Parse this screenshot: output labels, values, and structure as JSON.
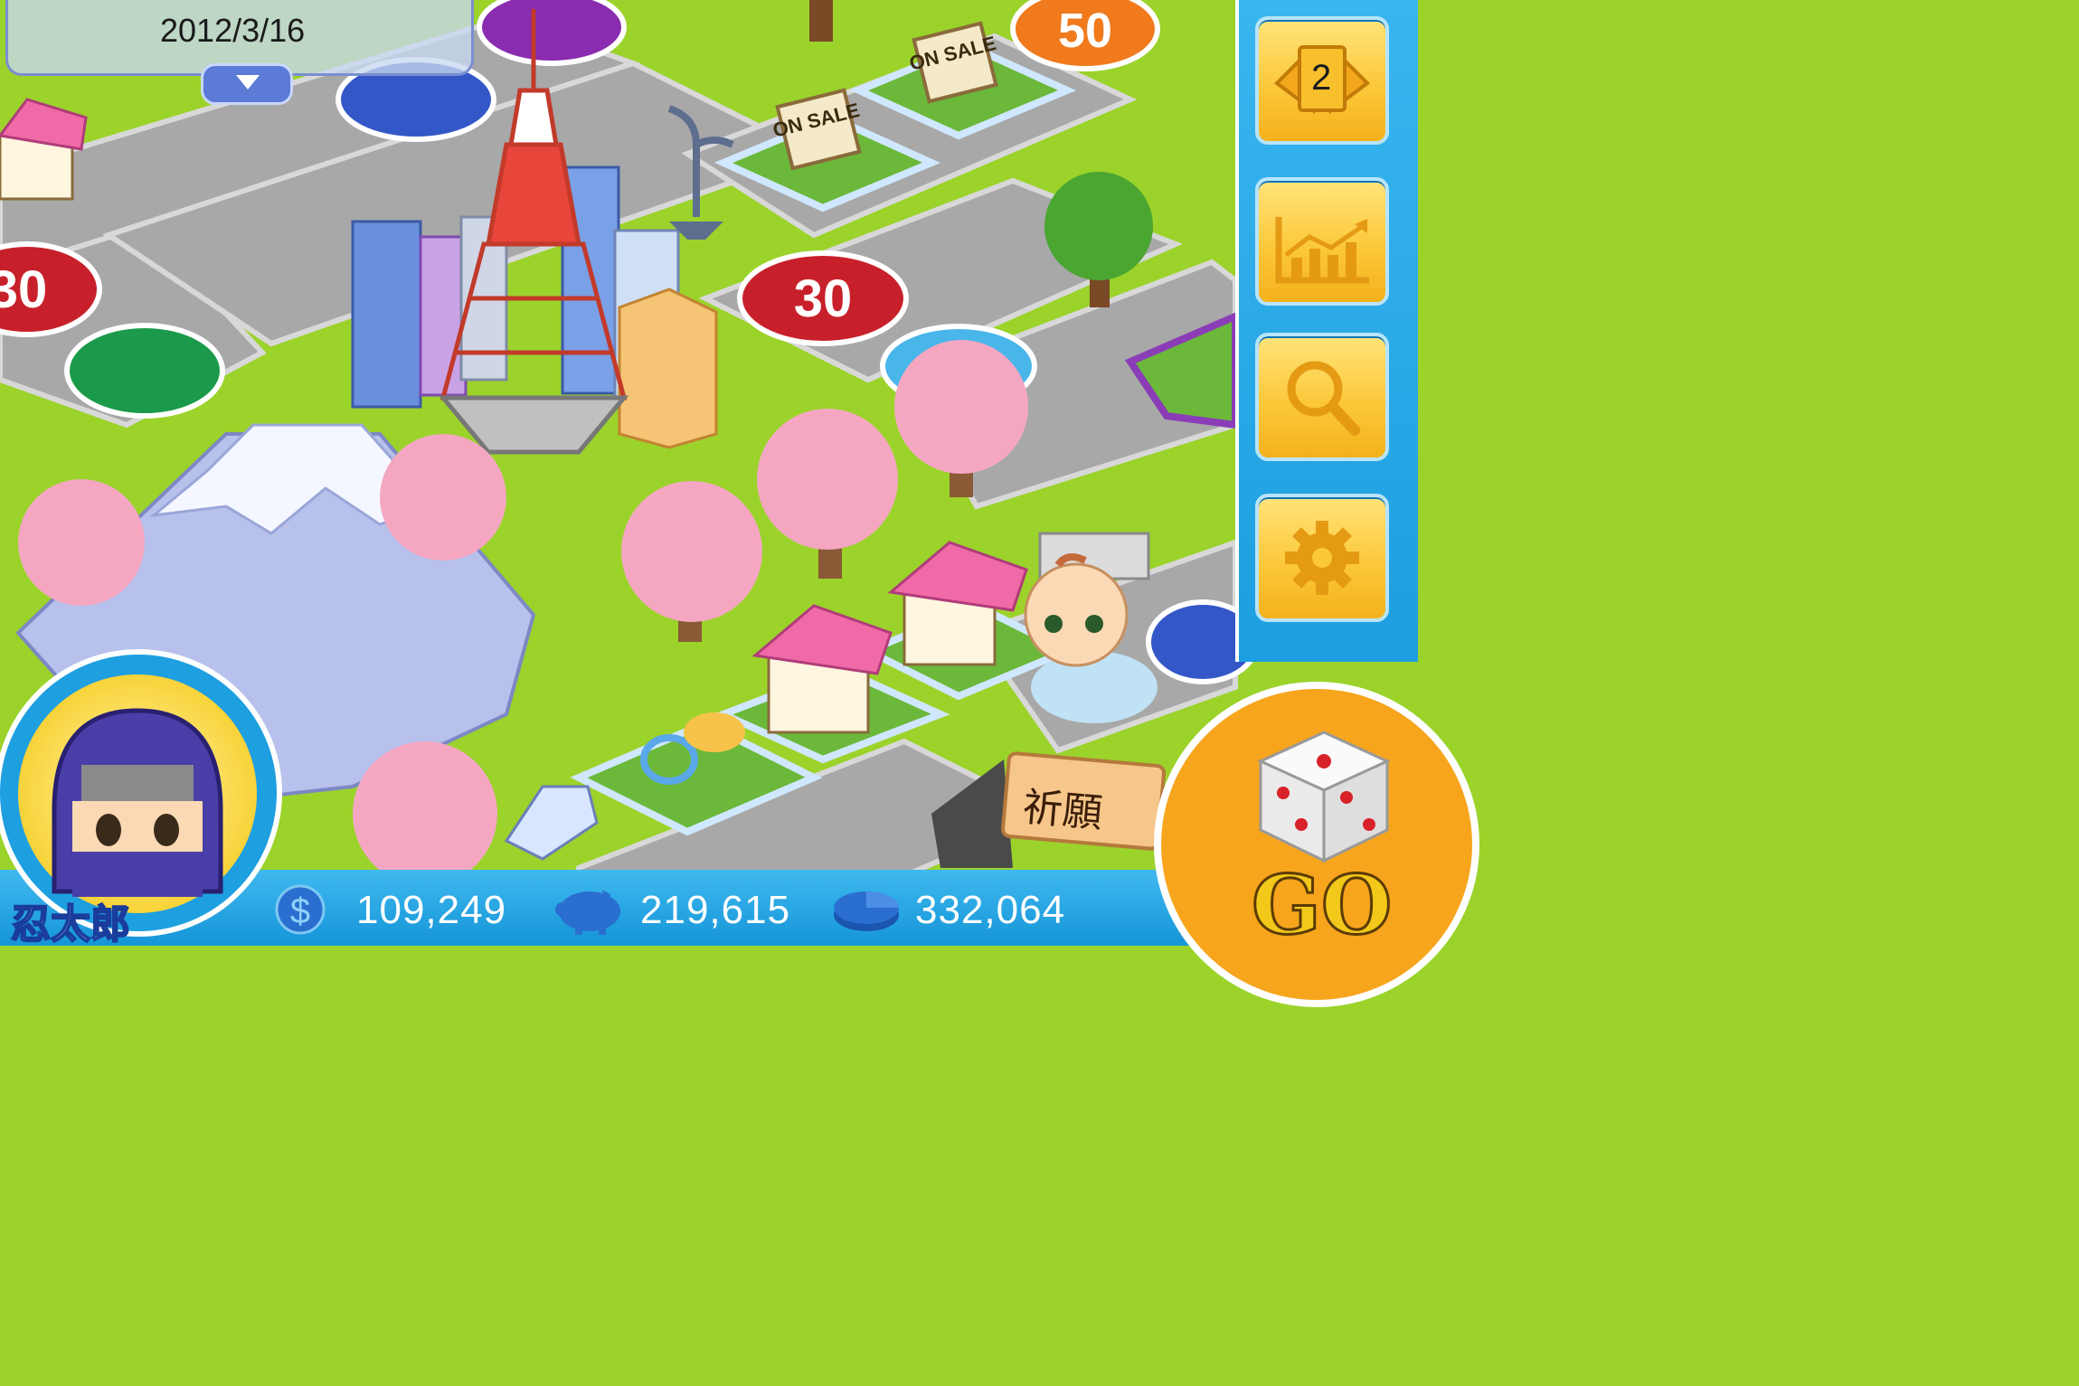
{
  "header": {
    "date": "2012/3/16"
  },
  "side_panel": {
    "buttons": [
      {
        "name": "cards",
        "icon": "cards-icon",
        "count": "2"
      },
      {
        "name": "stocks",
        "icon": "stock-chart-icon"
      },
      {
        "name": "search",
        "icon": "magnifier-icon"
      },
      {
        "name": "settings",
        "icon": "gear-icon"
      }
    ]
  },
  "board": {
    "sale_signs": [
      "ON SALE",
      "ON SALE"
    ],
    "wish_sign": "祈願",
    "coin_tiles": [
      "30",
      "50",
      "30"
    ]
  },
  "player": {
    "name": "忍太郎"
  },
  "stats": {
    "cash": "109,249",
    "savings": "219,615",
    "assets": "332,064"
  },
  "go_button": {
    "label": "GO"
  },
  "colors": {
    "panel_blue": "#1d9ee0",
    "button_yellow": "#fcc83a",
    "grass": "#9bd32b",
    "road": "#a9a9a9"
  }
}
